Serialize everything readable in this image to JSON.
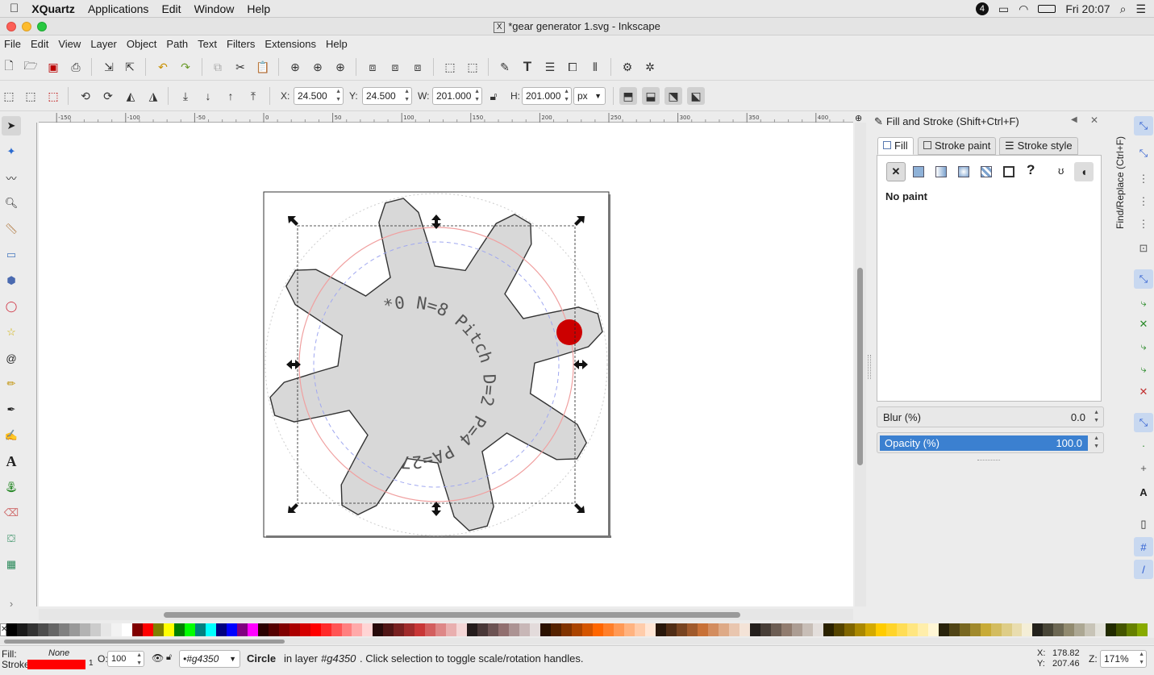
{
  "mac_menu": {
    "app_name": "XQuartz",
    "items": [
      "Applications",
      "Edit",
      "Window",
      "Help"
    ],
    "notification_count": "4",
    "clock": "Fri 20:07"
  },
  "window": {
    "title": "*gear generator 1.svg - Inkscape"
  },
  "menu": {
    "items": [
      "File",
      "Edit",
      "View",
      "Layer",
      "Object",
      "Path",
      "Text",
      "Filters",
      "Extensions",
      "Help"
    ]
  },
  "tool_controls": {
    "x_label": "X:",
    "x_value": "24.500",
    "y_label": "Y:",
    "y_value": "24.500",
    "w_label": "W:",
    "w_value": "201.000",
    "h_label": "H:",
    "h_value": "201.000",
    "unit": "px"
  },
  "ruler": {
    "labels": [
      "-150",
      "-100",
      "-50",
      "0",
      "50",
      "100",
      "150",
      "200",
      "250",
      "300",
      "350",
      "400"
    ]
  },
  "canvas": {
    "gear_text": "*0 N=8 Pitch D=2 P=4 PA=27",
    "gear_fill": "#d8d8d8",
    "pitch_circle_color": "#f0a0a0",
    "base_circle_color": "#a0a8f0",
    "selected_circle_color": "#cc0000"
  },
  "panel": {
    "title": "Fill and Stroke (Shift+Ctrl+F)",
    "tabs": [
      "Fill",
      "Stroke paint",
      "Stroke style"
    ],
    "paint_status": "No paint",
    "paint_unknown_glyph": "?",
    "blur_label": "Blur (%)",
    "blur_value": "0.0",
    "opacity_label": "Opacity (%)",
    "opacity_value": "100.0",
    "side_tab": "Find/Replace (Ctrl+F)"
  },
  "status": {
    "fill_label": "Fill:",
    "fill_value": "None",
    "stroke_label": "Stroke:",
    "stroke_width": "1",
    "opacity_label": "O:",
    "opacity_value": "100",
    "layer": "•#g4350",
    "object_type": "Circle",
    "message_prefix": "in layer",
    "message_layer": "#g4350",
    "message_suffix": ". Click selection to toggle scale/rotation handles.",
    "x_label": "X:",
    "x_value": "178.82",
    "y_label": "Y:",
    "y_value": "207.46",
    "zoom_label": "Z:",
    "zoom_value": "171%"
  },
  "palette": [
    "#000000",
    "#1a1a1a",
    "#333333",
    "#4d4d4d",
    "#666666",
    "#808080",
    "#999999",
    "#b3b3b3",
    "#cccccc",
    "#e6e6e6",
    "#f2f2f2",
    "#ffffff",
    "#800000",
    "#ff0000",
    "#808000",
    "#ffff00",
    "#008000",
    "#00ff00",
    "#008080",
    "#00ffff",
    "#000080",
    "#0000ff",
    "#800080",
    "#ff00ff",
    "#2b0000",
    "#550000",
    "#800000",
    "#aa0000",
    "#d40000",
    "#ff0000",
    "#ff2a2a",
    "#ff5555",
    "#ff8080",
    "#ffaaaa",
    "#ffd5d5",
    "#280b0b",
    "#501616",
    "#782121",
    "#a02c2c",
    "#c83737",
    "#d35f5f",
    "#de8787",
    "#e9afaf",
    "#f4d7d7",
    "#241c1c",
    "#483737",
    "#6c5353",
    "#916f6f",
    "#ac9393",
    "#c8b7b7",
    "#e3dbdb",
    "#2b1100",
    "#552200",
    "#803300",
    "#aa4400",
    "#d45500",
    "#ff6600",
    "#ff7f2a",
    "#ff9955",
    "#ffb380",
    "#ffccaa",
    "#ffe6d5",
    "#28170b",
    "#502d16",
    "#784421",
    "#a05a2c",
    "#c87137",
    "#d38d5f",
    "#deaa87",
    "#e9c6af",
    "#f4e3d7",
    "#241f1c",
    "#483e37",
    "#6c5d53",
    "#917c6f",
    "#ac9d93",
    "#c8beb7",
    "#e3dedb",
    "#2b2200",
    "#554400",
    "#806600",
    "#aa8800",
    "#d4aa00",
    "#ffcc00",
    "#ffd42a",
    "#ffdd55",
    "#ffe680",
    "#ffeeaa",
    "#fff6d5",
    "#28220b",
    "#504416",
    "#786721",
    "#a0892c",
    "#c8ab37",
    "#d3bc5f",
    "#decd87",
    "#e9ddaf",
    "#f4eed7",
    "#24221c",
    "#484537",
    "#6c6753",
    "#918a6f",
    "#aca793",
    "#c8c4b7",
    "#e3e2db",
    "#222b00",
    "#445500",
    "#668000",
    "#88aa00"
  ]
}
